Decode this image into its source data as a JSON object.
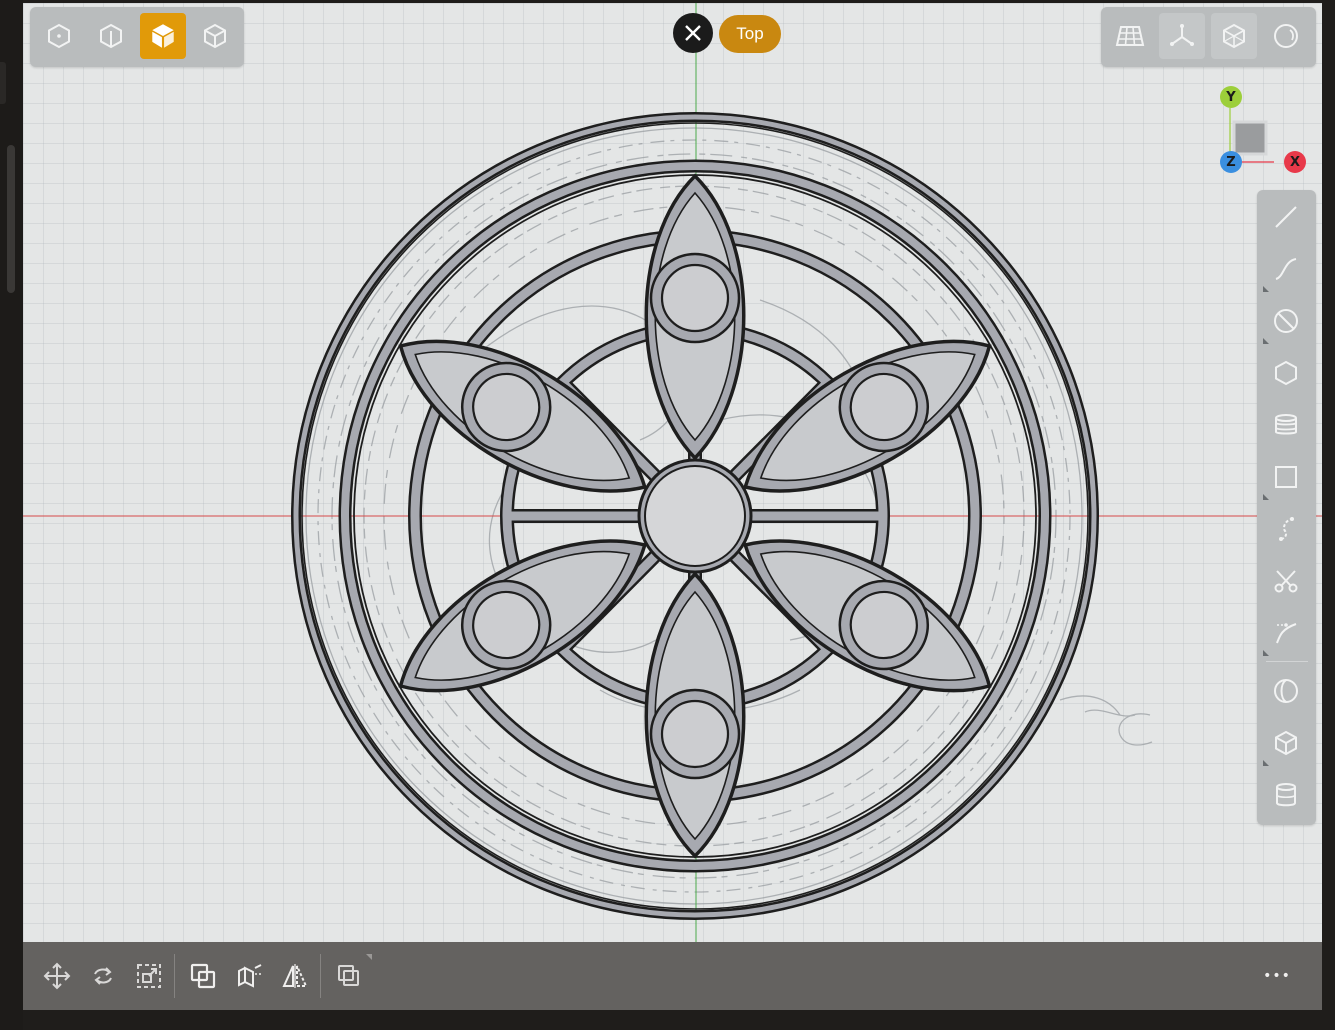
{
  "app": {
    "view": {
      "current_view_label": "Top",
      "close_label": "×"
    },
    "axis_gizmo": {
      "y_label": "Y",
      "x_label": "X",
      "z_label": "Z"
    },
    "bottom_bar": {
      "more_label": "•••"
    }
  },
  "colors": {
    "accent": "#e19a09",
    "view_badge": "#c98810",
    "axis_x": "#e8394a",
    "axis_y": "#9ccf3a",
    "axis_z": "#3a8fe0",
    "viewport_bg": "#e4e6e6",
    "panel": "#b9bcbd",
    "fill": "#a7a9b0"
  },
  "icons": {
    "view_modes": [
      "hex-outline-icon",
      "cube-side-icon",
      "cube-solid-icon",
      "cube-outline-icon"
    ],
    "display_modes": [
      "grid-icon",
      "axes-icon",
      "wireframe-icon",
      "sphere-icon"
    ],
    "tools": [
      "line-icon",
      "curve-icon",
      "circle-icon",
      "polygon-icon",
      "stack-icon",
      "rectangle-icon",
      "spline-icon",
      "scissors-icon",
      "pen-icon",
      "revolve-icon",
      "box-icon",
      "cylinder-icon"
    ],
    "bottom": [
      "move-icon",
      "rotate-icon",
      "scale-icon",
      "boolean-icon",
      "extrude-icon",
      "mirror-icon",
      "duplicate-icon",
      "more-icon"
    ]
  }
}
